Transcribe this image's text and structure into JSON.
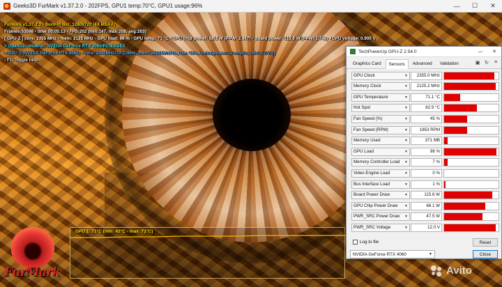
{
  "furmark": {
    "window_title": "Geeks3D FurMark v1.37.2.0 - 202FPS, GPU1 temp:70°C, GPU1 usage:96%",
    "overlay": [
      {
        "text": "FurMark v1.37.2.0 - Burn-in test, 1280x720 (4X MSAA)",
        "color": "yellow"
      },
      {
        "text": "Frames:53598 - time:00:05:13 - FPS:202 (min:147, max:208, avg:203)",
        "color": "white"
      },
      {
        "text": "[ GPU-Z ] core: 2355 MHz - mem: 2125 MHz - GPU load: 96 % - GPU temp: 71 °C - GPU chip power: 68.1 W (PPW: 2.967) - Board power: 115.6 W (PPW: 1.748) - GPU voltage: 0.900 V",
        "color": "white"
      },
      {
        "text": "> OpenGL renderer: NVIDIA GeForce RTX 4060/PCIe/SSE2",
        "color": "cyan"
      },
      {
        "text": "> GPU 1 (NVIDIA GeForce RTX 4060) - core: 2340MHz/70°C/96%, mem: 8500MHz/4%, fan: 45%, limits(power:1, temp:0, volt:0, OV:0)",
        "color": "blue"
      },
      {
        "text": "- F1: toggle help",
        "color": "gray"
      }
    ],
    "graph_label": "GPU 1: 71°C (min: 42°C - max: 71°C)",
    "logo_text": "FurMark"
  },
  "gpuz": {
    "window_title": "TechPowerUp GPU-Z 2.54.0",
    "tabs": [
      {
        "label": "Graphics Card",
        "active": false
      },
      {
        "label": "Sensors",
        "active": true
      },
      {
        "label": "Advanced",
        "active": false
      },
      {
        "label": "Validation",
        "active": false
      }
    ],
    "sensors": [
      {
        "name": "GPU Clock",
        "value": "2355.0 MHz",
        "level": 0.92
      },
      {
        "name": "Memory Clock",
        "value": "2125.2 MHz",
        "level": 0.95
      },
      {
        "name": "GPU Temperature",
        "value": "71.1 °C",
        "level": 0.3
      },
      {
        "name": "Hot Spot",
        "value": "82.9 °C",
        "level": 0.6
      },
      {
        "name": "Fan Speed (%)",
        "value": "45 %",
        "level": 0.42
      },
      {
        "name": "Fan Speed (RPM)",
        "value": "1853 RPM",
        "level": 0.42
      },
      {
        "name": "Memory Used",
        "value": "371 MB",
        "level": 0.06
      },
      {
        "name": "GPU Load",
        "value": "96 %",
        "level": 0.96
      },
      {
        "name": "Memory Controller Load",
        "value": "7 %",
        "level": 0.07
      },
      {
        "name": "Video Engine Load",
        "value": "0 %",
        "level": 0.0
      },
      {
        "name": "Bus Interface Load",
        "value": "1 %",
        "level": 0.02
      },
      {
        "name": "Board Power Draw",
        "value": "115.6 W",
        "level": 0.88
      },
      {
        "name": "GPU Chip Power Draw",
        "value": "68.1 W",
        "level": 0.75
      },
      {
        "name": "PWR_SRC Power Draw",
        "value": "47.5 W",
        "level": 0.7
      },
      {
        "name": "PWR_SRC Voltage",
        "value": "12.0 V",
        "level": 0.95
      }
    ],
    "log_to_file_label": "Log to file",
    "reset_label": "Reset",
    "gpu_select": "NVIDIA GeForce RTX 4060",
    "close_label": "Close"
  },
  "watermark": "Avito",
  "colors": {
    "overlay_yellow": "#ffe600",
    "overlay_cyan": "#3fe6ff",
    "overlay_blue": "#5fb0ff",
    "sensor_bar": "#e00000"
  }
}
